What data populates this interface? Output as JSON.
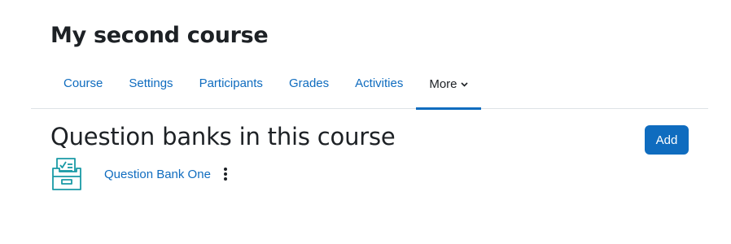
{
  "course": {
    "title": "My second course"
  },
  "nav": {
    "tabs": [
      {
        "label": "Course"
      },
      {
        "label": "Settings"
      },
      {
        "label": "Participants"
      },
      {
        "label": "Grades"
      },
      {
        "label": "Activities"
      },
      {
        "label": "More",
        "active": true
      }
    ]
  },
  "page": {
    "heading": "Question banks in this course",
    "add_label": "Add"
  },
  "banks": [
    {
      "name": "Question Bank One",
      "icon": "question-bank-icon"
    }
  ],
  "colors": {
    "link": "#0f6cbf",
    "accent": "#0f6cbf",
    "icon": "#1a9aa6",
    "text": "#1d2125"
  }
}
